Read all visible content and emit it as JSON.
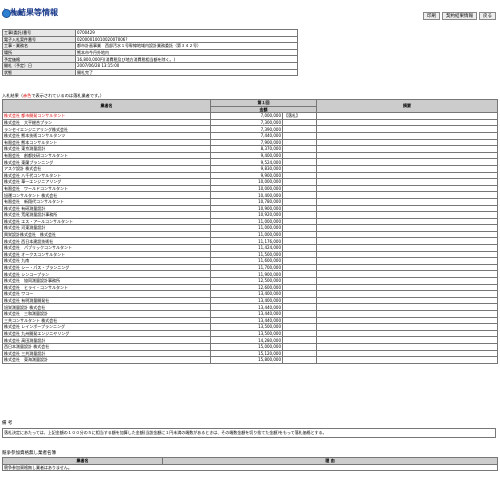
{
  "page": {
    "title": "入札結果等情報",
    "sub_label": "閉鎖",
    "buttons": [
      "印刷",
      "契約結果情報",
      "戻る"
    ]
  },
  "info": [
    {
      "key": "工事(委託)番号",
      "value": "0700429"
    },
    {
      "key": "電子入札案件番号",
      "value": "0200001001002007006?"
    },
    {
      "key": "工事・業務名",
      "value": "都市計画事業　西部汚水１号幹線地域内設計業務委託（第３４２号）"
    },
    {
      "key": "場所",
      "value": "熊本市今丹外地内"
    },
    {
      "key": "予定価格",
      "value": "16,800,000円(消費税及び地方消費税相当額を除く。)"
    },
    {
      "key": "開札（予定）日",
      "value": "2007/06/28 13:15:00"
    },
    {
      "key": "状態",
      "value": "開札完了"
    }
  ],
  "results": {
    "caption_prefix": "入札結果（",
    "caption_red": "赤色",
    "caption_suffix": "で表示されているのは落札業者です。）",
    "header_company": "業者名",
    "header_round": "第１回",
    "header_amount": "金額",
    "header_note": "摘要",
    "rows": [
      {
        "name": "株式会社 都市開発コンサルタント",
        "amount": "7,000,000",
        "note": "【落札】",
        "winner": true
      },
      {
        "name": "株式会社　大平総合プラン",
        "amount": "7,300,000",
        "note": ""
      },
      {
        "name": "ランセイエンジニアリング株式会社",
        "amount": "7,390,000",
        "note": ""
      },
      {
        "name": "株式会社 熊本技術コンサルタンツ",
        "amount": "7,440,000",
        "note": ""
      },
      {
        "name": "有限会社 熊本コンサルタント",
        "amount": "7,900,000",
        "note": ""
      },
      {
        "name": "株式会社 東京測量設計",
        "amount": "8,370,000",
        "note": ""
      },
      {
        "name": "有限会社　創都技研コンサルタント",
        "amount": "9,400,000",
        "note": ""
      },
      {
        "name": "株式会社 東蘭プランニング",
        "amount": "9,524,000",
        "note": ""
      },
      {
        "name": "アスク設計 株式会社",
        "amount": "9,830,000",
        "note": ""
      },
      {
        "name": "株式会社 八千代コンサルタント",
        "amount": "9,900,000",
        "note": ""
      },
      {
        "name": "株式会社 華一エンジニアリング",
        "amount": "10,000,000",
        "note": ""
      },
      {
        "name": "有限会社　ワールドコンサルタント",
        "amount": "10,000,000",
        "note": ""
      },
      {
        "name": "旭運コンサルタント 株式会社",
        "amount": "10,400,000",
        "note": ""
      },
      {
        "name": "有限会社　新翔代コンサルタント",
        "amount": "10,780,000",
        "note": ""
      },
      {
        "name": "株式会社 有研測量設計",
        "amount": "10,900,000",
        "note": ""
      },
      {
        "name": "株式会社 荒尾測量設計事務所",
        "amount": "10,920,000",
        "note": ""
      },
      {
        "name": "株式会社 エス・アールコンサルタント",
        "amount": "11,000,000",
        "note": ""
      },
      {
        "name": "株式会社 河東測量設計",
        "amount": "11,000,000",
        "note": ""
      },
      {
        "name": "興栄設計株式会社　株式会社",
        "amount": "11,000,000",
        "note": ""
      },
      {
        "name": "株式会社 西日本建設技術社",
        "amount": "11,176,000",
        "note": ""
      },
      {
        "name": "株式会社　パブリックコンサルタント",
        "amount": "11,424,000",
        "note": ""
      },
      {
        "name": "株式会社 オークスコンサルタント",
        "amount": "11,500,000",
        "note": ""
      },
      {
        "name": "株式会社 九南",
        "amount": "11,600,000",
        "note": ""
      },
      {
        "name": "株式会社 シー・パス・プランニング",
        "amount": "11,700,000",
        "note": ""
      },
      {
        "name": "株式会社 シンコープラン",
        "amount": "11,900,000",
        "note": ""
      },
      {
        "name": "株式会社　協同測量設計事務所",
        "amount": "12,500,000",
        "note": ""
      },
      {
        "name": "株式会社　ヒライ・コンサルタント",
        "amount": "12,600,000",
        "note": ""
      },
      {
        "name": "株式会社 ワコー",
        "amount": "13,400,000",
        "note": ""
      },
      {
        "name": "株式会社 有明測量開発社",
        "amount": "13,400,000",
        "note": ""
      },
      {
        "name": "旭栄測量設計 株式会社",
        "amount": "13,440,000",
        "note": ""
      },
      {
        "name": "株式会社　三和測量設計",
        "amount": "13,440,000",
        "note": ""
      },
      {
        "name": "三共コンサルタント 株式会社",
        "amount": "13,440,000",
        "note": ""
      },
      {
        "name": "株式会社 レインボープランニング",
        "amount": "13,500,000",
        "note": ""
      },
      {
        "name": "株式会社 九州開発エンジニヤリング",
        "amount": "13,500,000",
        "note": ""
      },
      {
        "name": "株式会社 高田測量設計",
        "amount": "14,280,000",
        "note": ""
      },
      {
        "name": "西日本測量設計 株式会社",
        "amount": "15,000,000",
        "note": ""
      },
      {
        "name": "株式会社 三共測量設計",
        "amount": "15,120,000",
        "note": ""
      },
      {
        "name": "株式会社　東海測量設計",
        "amount": "15,800,000",
        "note": ""
      }
    ]
  },
  "remarks": {
    "label": "備 考",
    "text": "落札決定にあたっては、上記金額の１００分の５に相当する額を加算した金額(当該金額に１円未満の端数があるときは、その端数金額を切り捨てた金額)をもって落札価格とする。"
  },
  "declined": {
    "label": "競争参加資格無し業者名簿",
    "header_company": "業者名",
    "header_reason": "理 由",
    "empty_text": "競争参加資格無し業者はありません。"
  }
}
